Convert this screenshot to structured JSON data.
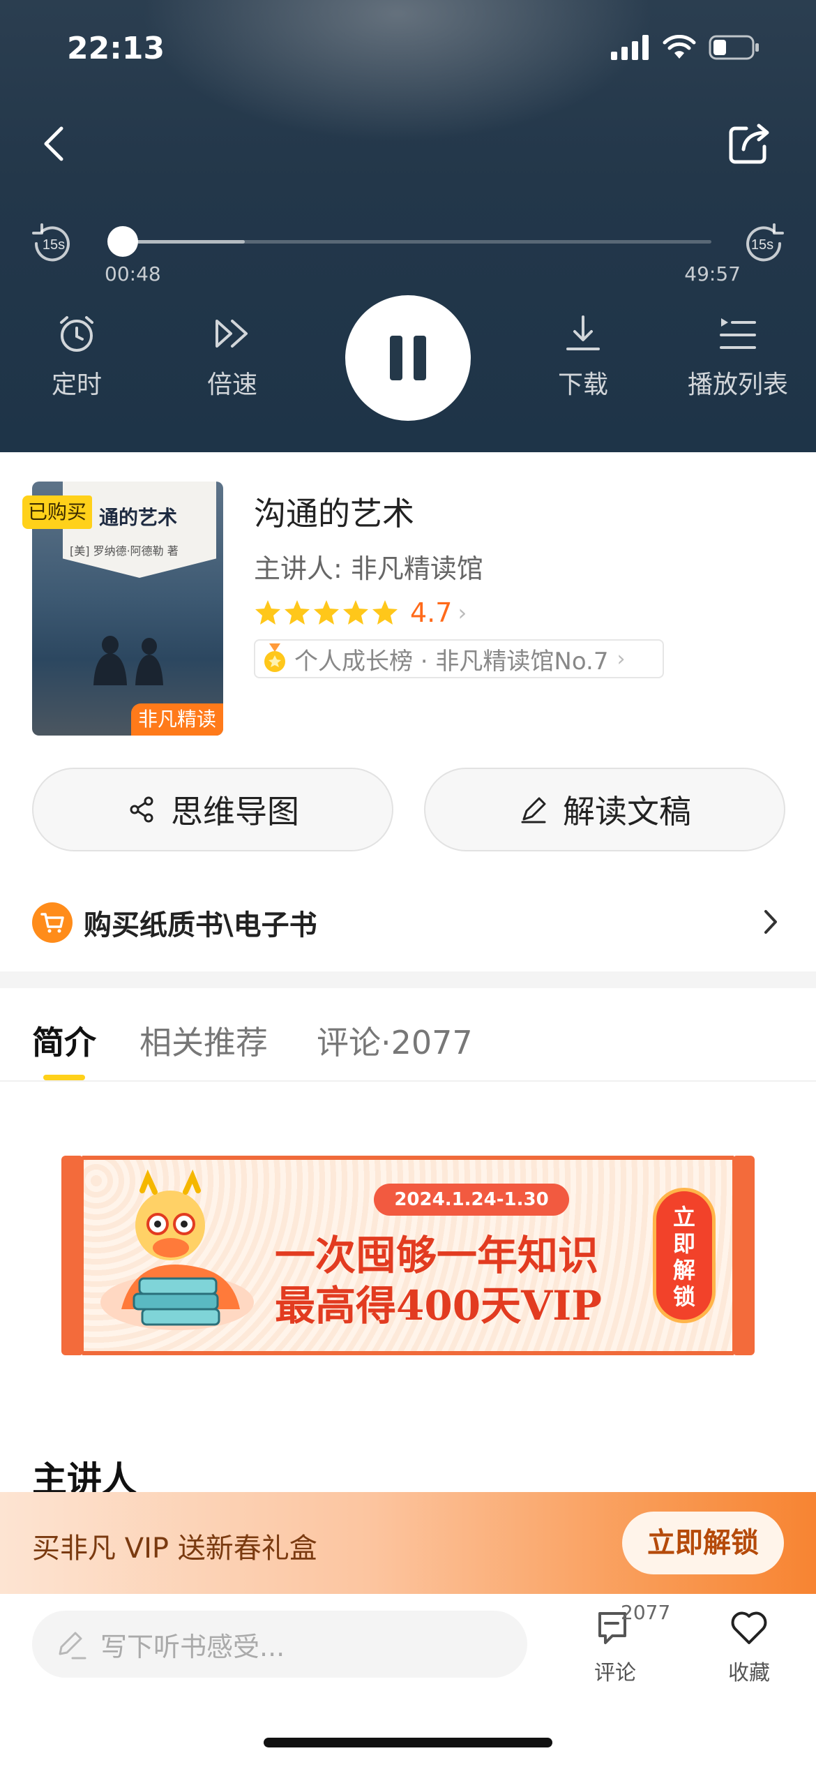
{
  "status_bar": {
    "time": "22:13"
  },
  "player": {
    "skip_back_label": "15s",
    "skip_forward_label": "15s",
    "current_time": "00:48",
    "total_time": "49:57",
    "progress_fraction": 0.016,
    "buffered_fraction": 0.22,
    "is_playing": true,
    "controls": [
      {
        "label": "定时",
        "icon": "alarm-clock-icon"
      },
      {
        "label": "倍速",
        "icon": "fast-forward-icon"
      },
      {
        "label": "下载",
        "icon": "download-icon"
      },
      {
        "label": "播放列表",
        "icon": "playlist-icon"
      }
    ]
  },
  "book": {
    "cover_title": "通的艺术",
    "cover_author": "[美] 罗纳德·阿德勒 著",
    "badge_bought": "已购买",
    "badge_brand": "非凡精读",
    "title": "沟通的艺术",
    "speaker": "主讲人: 非凡精读馆",
    "rating": "4.7",
    "rating_stars": 5,
    "rank": "个人成长榜 · 非凡精读馆No.7"
  },
  "actions": {
    "mind_map": "思维导图",
    "transcript": "解读文稿",
    "buy_paper": "购买纸质书\\电子书"
  },
  "tabs": [
    {
      "label": "简介",
      "active": true
    },
    {
      "label": "相关推荐",
      "active": false
    },
    {
      "label": "评论·2077",
      "active": false
    }
  ],
  "promo": {
    "date": "2024.1.24-1.30",
    "line1": "一次囤够一年知识",
    "line2": "最高得400天VIP",
    "unlock": "立即解锁"
  },
  "section": {
    "speaker_title": "主讲人"
  },
  "vip_bar": {
    "text": "买非凡 VIP 送新春礼盒",
    "button": "立即解锁"
  },
  "bottom_bar": {
    "comment_placeholder": "写下听书感受...",
    "comment_count": "2077",
    "comment_label": "评论",
    "favorite_label": "收藏"
  },
  "colors": {
    "accent_orange": "#ff6a1a",
    "tab_indicator": "#ffd11a",
    "player_bg": "#23374a"
  }
}
